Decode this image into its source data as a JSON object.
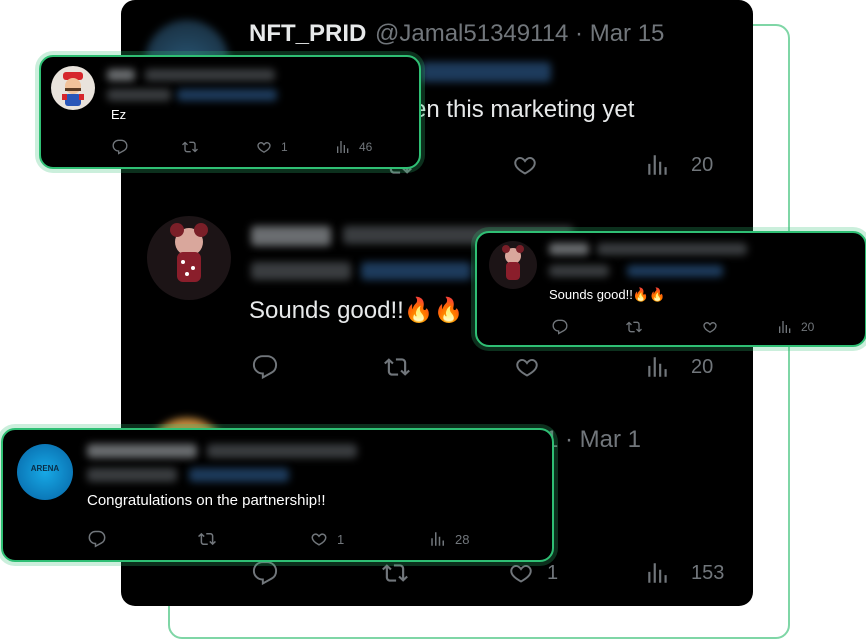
{
  "feed": {
    "top_tweet": {
      "name": "NFT_PRID",
      "handle_date": "@Jamal51349114 · Mar 15",
      "text_fragment": "en this marketing yet",
      "views": "20"
    },
    "mid_tweet": {
      "text": "Sounds good!!🔥🔥",
      "views": "20"
    },
    "bottom_tweet": {
      "date_fragment": "1 · Mar 1",
      "likes": "1",
      "views": "153"
    }
  },
  "cards": {
    "card_ez": {
      "text": "Ez",
      "likes": "1",
      "views": "46"
    },
    "card_sounds": {
      "text": "Sounds good!!🔥🔥",
      "views": "20"
    },
    "card_congrats": {
      "avatar_text": "ARENA",
      "text": "Congratulations on the partnership!!",
      "likes": "1",
      "views": "28"
    }
  },
  "icons": [
    "reply-icon",
    "retweet-icon",
    "like-icon",
    "views-icon"
  ],
  "colors": {
    "background": "#000000",
    "accent_green": "#2fbf74",
    "muted_text": "#71767b",
    "frame_green": "#7fd6a6"
  }
}
